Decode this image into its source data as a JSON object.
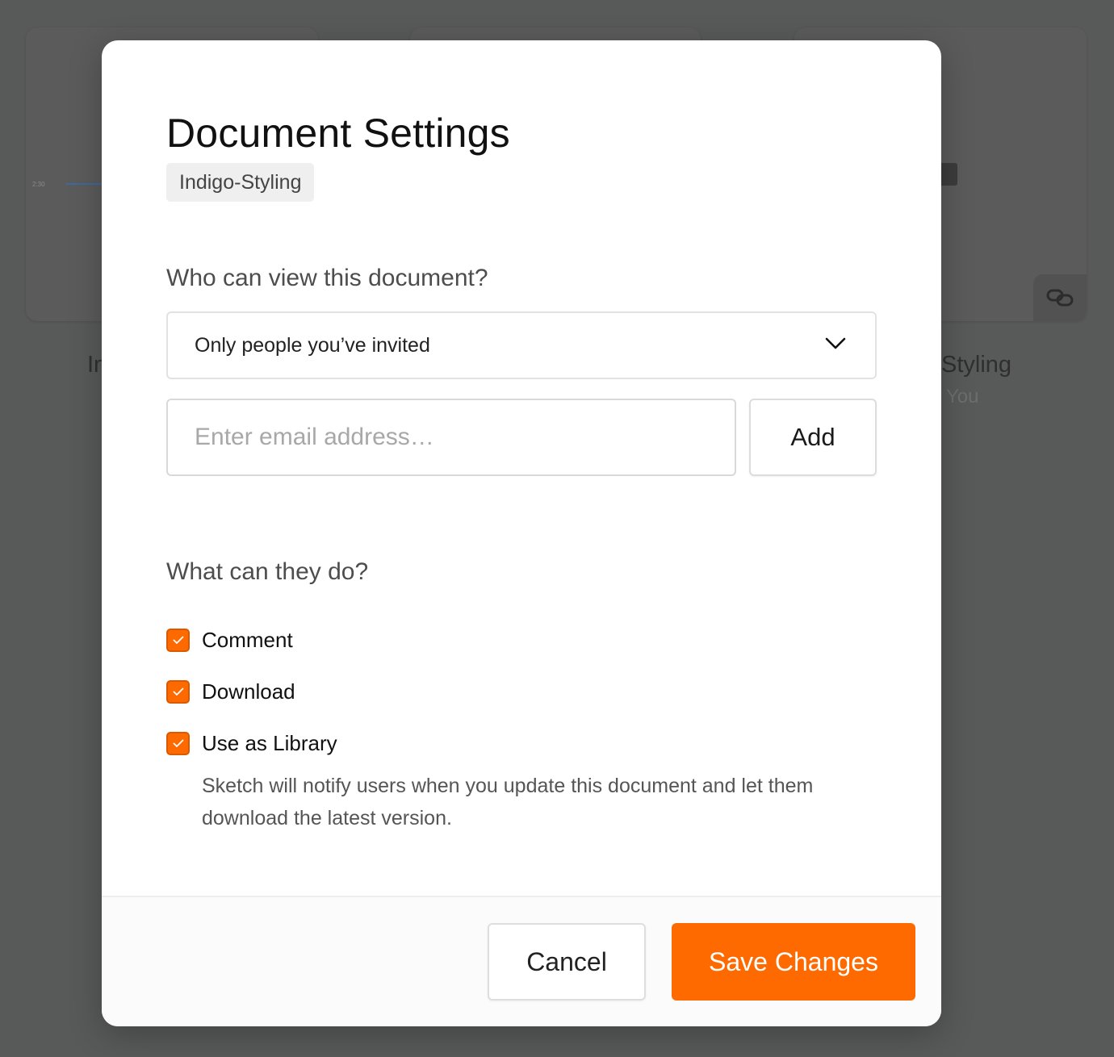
{
  "background": {
    "cards": [
      {
        "tick_label": "2:30"
      },
      {},
      {}
    ],
    "left_title_partial": "In",
    "right_title_partial": "Styling",
    "right_subtitle_partial": "You"
  },
  "dialog": {
    "title": "Document Settings",
    "document_tag": "Indigo-Styling",
    "visibility": {
      "label": "Who can view this document?",
      "selected_option": "Only people you’ve invited"
    },
    "invite": {
      "email_placeholder": "Enter email address…",
      "email_value": "",
      "add_label": "Add"
    },
    "permissions": {
      "label": "What can they do?",
      "items": [
        {
          "label": "Comment",
          "checked": true
        },
        {
          "label": "Download",
          "checked": true
        },
        {
          "label": "Use as Library",
          "checked": true
        }
      ],
      "library_description": "Sketch will notify users when you update this document and let them download the latest version."
    },
    "footer": {
      "cancel_label": "Cancel",
      "save_label": "Save Changes"
    }
  },
  "colors": {
    "accent": "#FF6A00",
    "overlay": "#585959",
    "modal_bg": "#FFFFFF"
  },
  "icons": {
    "select_chevron": "chevron-down-icon",
    "checkbox_mark": "checkmark-icon",
    "card_link": "link-icon"
  }
}
